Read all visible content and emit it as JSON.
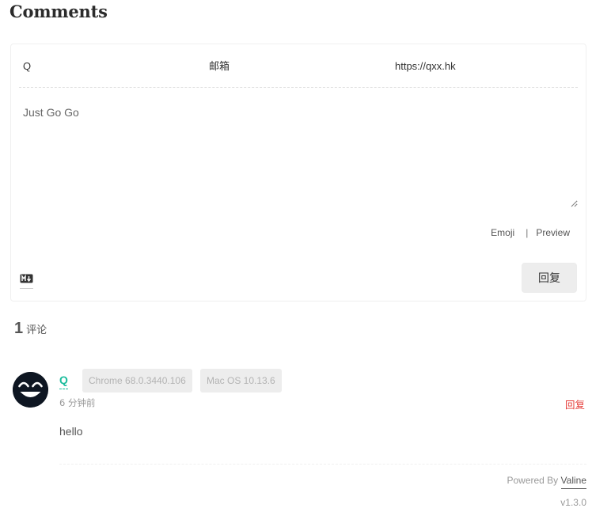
{
  "page": {
    "title": "Comments"
  },
  "form": {
    "nick_placeholder": "Q",
    "mail_placeholder": "邮箱",
    "link_placeholder": "https://qxx.hk",
    "editor_placeholder": "Just Go Go",
    "tools": {
      "emoji": "Emoji",
      "separator": "|",
      "preview": "Preview"
    },
    "markdown_icon": "markdown-icon",
    "submit_label": "回复"
  },
  "summary": {
    "count": "1",
    "label": "评论"
  },
  "comments": [
    {
      "nick": "Q",
      "browser": "Chrome 68.0.3440.106",
      "os": "Mac OS 10.13.6",
      "time": "6 分钟前",
      "reply_label": "回复",
      "content": "hello",
      "avatar_icon": "smiley-face-avatar"
    }
  ],
  "footer": {
    "powered_by": "Powered By",
    "brand": "Valine",
    "version": "v1.3.0"
  },
  "colors": {
    "nick": "#1abc9c",
    "reply": "#e53935",
    "badge_bg": "#ededed"
  }
}
